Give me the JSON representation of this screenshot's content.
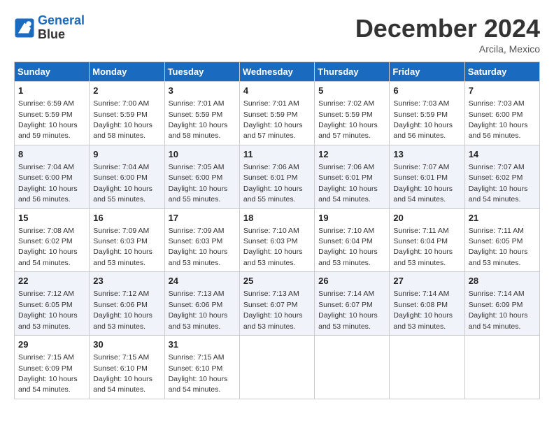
{
  "header": {
    "logo_line1": "General",
    "logo_line2": "Blue",
    "month_title": "December 2024",
    "location": "Arcila, Mexico"
  },
  "weekdays": [
    "Sunday",
    "Monday",
    "Tuesday",
    "Wednesday",
    "Thursday",
    "Friday",
    "Saturday"
  ],
  "weeks": [
    [
      {
        "day": "1",
        "sunrise": "6:59 AM",
        "sunset": "5:59 PM",
        "daylight": "10 hours and 59 minutes."
      },
      {
        "day": "2",
        "sunrise": "7:00 AM",
        "sunset": "5:59 PM",
        "daylight": "10 hours and 58 minutes."
      },
      {
        "day": "3",
        "sunrise": "7:01 AM",
        "sunset": "5:59 PM",
        "daylight": "10 hours and 58 minutes."
      },
      {
        "day": "4",
        "sunrise": "7:01 AM",
        "sunset": "5:59 PM",
        "daylight": "10 hours and 57 minutes."
      },
      {
        "day": "5",
        "sunrise": "7:02 AM",
        "sunset": "5:59 PM",
        "daylight": "10 hours and 57 minutes."
      },
      {
        "day": "6",
        "sunrise": "7:03 AM",
        "sunset": "5:59 PM",
        "daylight": "10 hours and 56 minutes."
      },
      {
        "day": "7",
        "sunrise": "7:03 AM",
        "sunset": "6:00 PM",
        "daylight": "10 hours and 56 minutes."
      }
    ],
    [
      {
        "day": "8",
        "sunrise": "7:04 AM",
        "sunset": "6:00 PM",
        "daylight": "10 hours and 56 minutes."
      },
      {
        "day": "9",
        "sunrise": "7:04 AM",
        "sunset": "6:00 PM",
        "daylight": "10 hours and 55 minutes."
      },
      {
        "day": "10",
        "sunrise": "7:05 AM",
        "sunset": "6:00 PM",
        "daylight": "10 hours and 55 minutes."
      },
      {
        "day": "11",
        "sunrise": "7:06 AM",
        "sunset": "6:01 PM",
        "daylight": "10 hours and 55 minutes."
      },
      {
        "day": "12",
        "sunrise": "7:06 AM",
        "sunset": "6:01 PM",
        "daylight": "10 hours and 54 minutes."
      },
      {
        "day": "13",
        "sunrise": "7:07 AM",
        "sunset": "6:01 PM",
        "daylight": "10 hours and 54 minutes."
      },
      {
        "day": "14",
        "sunrise": "7:07 AM",
        "sunset": "6:02 PM",
        "daylight": "10 hours and 54 minutes."
      }
    ],
    [
      {
        "day": "15",
        "sunrise": "7:08 AM",
        "sunset": "6:02 PM",
        "daylight": "10 hours and 54 minutes."
      },
      {
        "day": "16",
        "sunrise": "7:09 AM",
        "sunset": "6:03 PM",
        "daylight": "10 hours and 53 minutes."
      },
      {
        "day": "17",
        "sunrise": "7:09 AM",
        "sunset": "6:03 PM",
        "daylight": "10 hours and 53 minutes."
      },
      {
        "day": "18",
        "sunrise": "7:10 AM",
        "sunset": "6:03 PM",
        "daylight": "10 hours and 53 minutes."
      },
      {
        "day": "19",
        "sunrise": "7:10 AM",
        "sunset": "6:04 PM",
        "daylight": "10 hours and 53 minutes."
      },
      {
        "day": "20",
        "sunrise": "7:11 AM",
        "sunset": "6:04 PM",
        "daylight": "10 hours and 53 minutes."
      },
      {
        "day": "21",
        "sunrise": "7:11 AM",
        "sunset": "6:05 PM",
        "daylight": "10 hours and 53 minutes."
      }
    ],
    [
      {
        "day": "22",
        "sunrise": "7:12 AM",
        "sunset": "6:05 PM",
        "daylight": "10 hours and 53 minutes."
      },
      {
        "day": "23",
        "sunrise": "7:12 AM",
        "sunset": "6:06 PM",
        "daylight": "10 hours and 53 minutes."
      },
      {
        "day": "24",
        "sunrise": "7:13 AM",
        "sunset": "6:06 PM",
        "daylight": "10 hours and 53 minutes."
      },
      {
        "day": "25",
        "sunrise": "7:13 AM",
        "sunset": "6:07 PM",
        "daylight": "10 hours and 53 minutes."
      },
      {
        "day": "26",
        "sunrise": "7:14 AM",
        "sunset": "6:07 PM",
        "daylight": "10 hours and 53 minutes."
      },
      {
        "day": "27",
        "sunrise": "7:14 AM",
        "sunset": "6:08 PM",
        "daylight": "10 hours and 53 minutes."
      },
      {
        "day": "28",
        "sunrise": "7:14 AM",
        "sunset": "6:09 PM",
        "daylight": "10 hours and 54 minutes."
      }
    ],
    [
      {
        "day": "29",
        "sunrise": "7:15 AM",
        "sunset": "6:09 PM",
        "daylight": "10 hours and 54 minutes."
      },
      {
        "day": "30",
        "sunrise": "7:15 AM",
        "sunset": "6:10 PM",
        "daylight": "10 hours and 54 minutes."
      },
      {
        "day": "31",
        "sunrise": "7:15 AM",
        "sunset": "6:10 PM",
        "daylight": "10 hours and 54 minutes."
      },
      null,
      null,
      null,
      null
    ]
  ]
}
